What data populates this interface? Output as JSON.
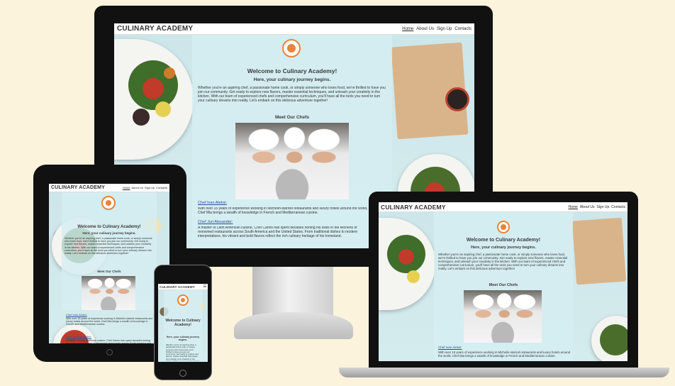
{
  "site": {
    "brand": "CULINARY ACADEMY",
    "nav": [
      "Home",
      "About Us",
      "Sign Up",
      "Contacts"
    ],
    "welcome": "Welcome to Culinary Academy!",
    "tagline": "Here, your culinary journey begins.",
    "intro": "Whether you're an aspiring chef, a passionate home cook, or simply someone who loves food, we're thrilled to have you join our community. Get ready to explore new flavors, master essential techniques, and unleash your creativity in the kitchen. With our team of experienced chefs and comprehensive curriculum, you'll have all the tools you need to turn your culinary dreams into reality. Let's embark on this delicious adventure together!",
    "meet_chefs": "Meet Our Chefs",
    "chef1_name": "Chef Ivan Aleksi:",
    "chef1_bio": "With over 15 years of experience working in Michelin-starred restaurants and luxury hotels around the world, Chef Mia brings a wealth of knowledge in French and Mediterranean cuisine.",
    "chef2_name": "Chef Juri Alexander:",
    "chef2_bio": "A master of Latin American cuisine, Chef Carlos has spent decades honing his skills in the kitchens of renowned restaurants across South America and the United States. From traditional dishes to modern interpretations, his vibrant and bold flavors reflect the rich culinary heritage of his homeland."
  },
  "phone": {
    "welcome": "Welcome to Culinary Academy!"
  }
}
